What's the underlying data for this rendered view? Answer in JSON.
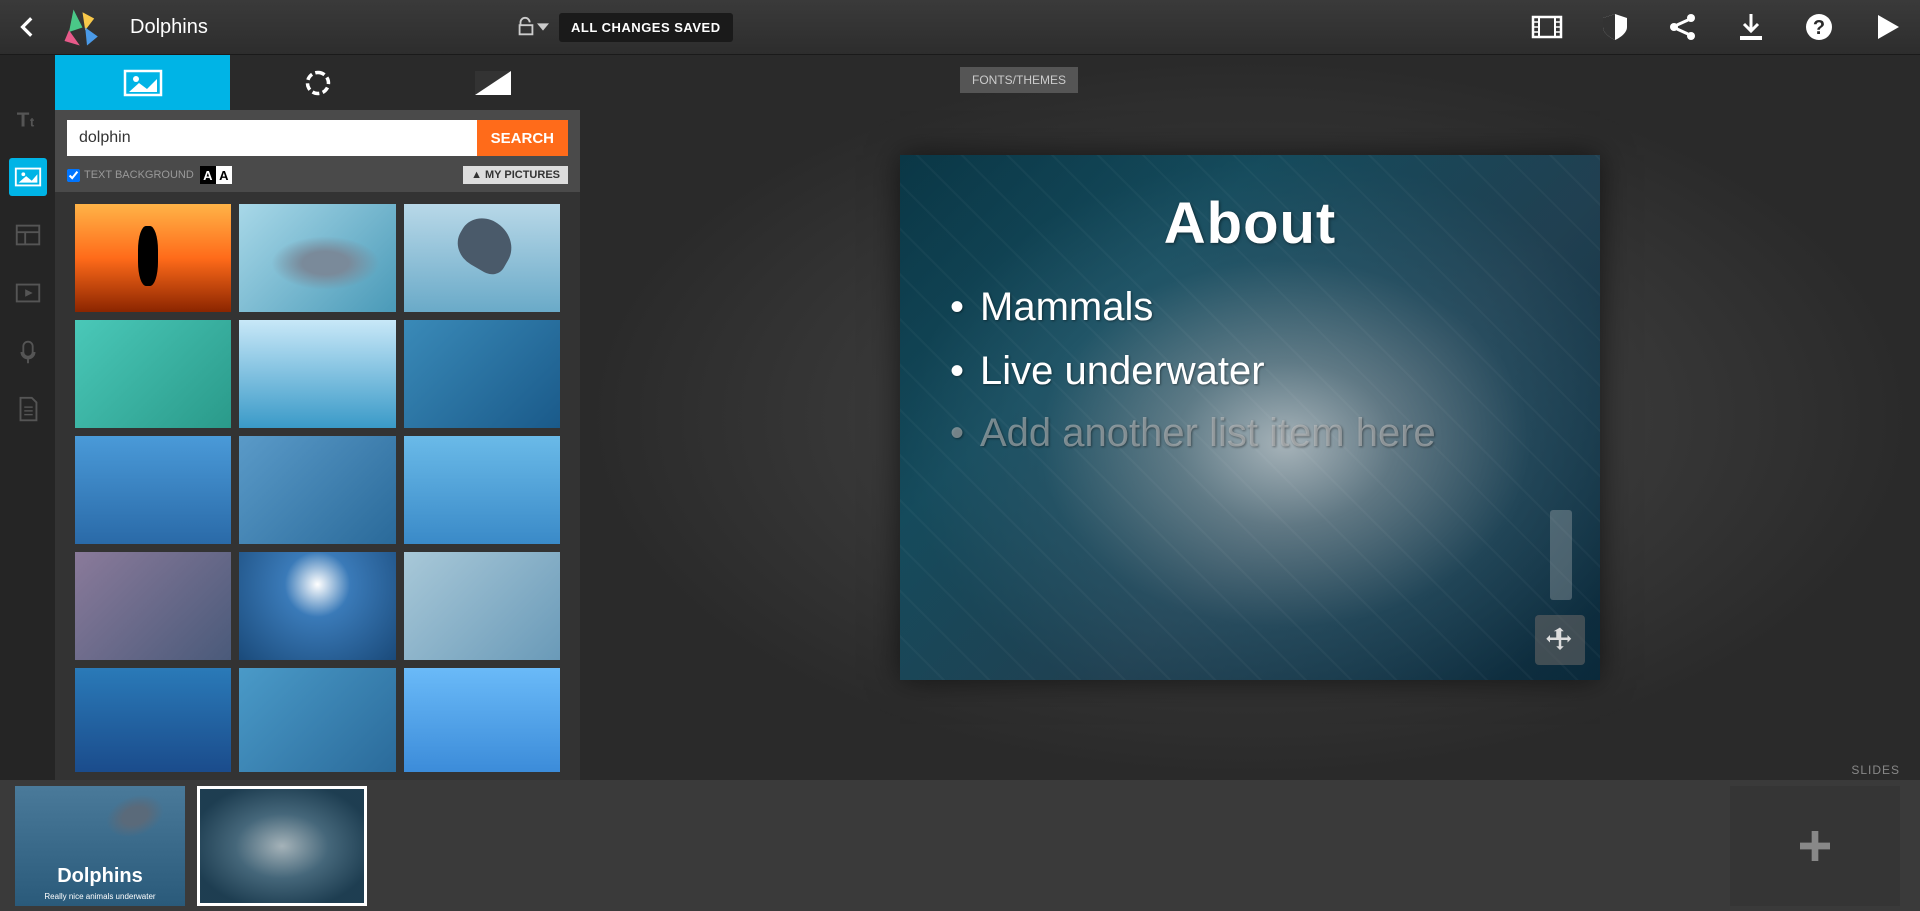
{
  "header": {
    "presentation_title": "Dolphins",
    "saved_status": "ALL CHANGES SAVED"
  },
  "panel": {
    "search_value": "dolphin",
    "search_button": "SEARCH",
    "text_background_label": "TEXT BACKGROUND",
    "my_pictures_label": "MY PICTURES"
  },
  "canvas": {
    "fonts_themes_label": "FONTS/THEMES",
    "slides_label": "SLIDES",
    "slide": {
      "title": "About",
      "bullets": [
        "Mammals",
        "Live underwater"
      ],
      "placeholder": "Add another list item here"
    }
  },
  "tray": {
    "thumb1_title": "Dolphins",
    "thumb1_subtitle": "Really nice animals underwater"
  }
}
